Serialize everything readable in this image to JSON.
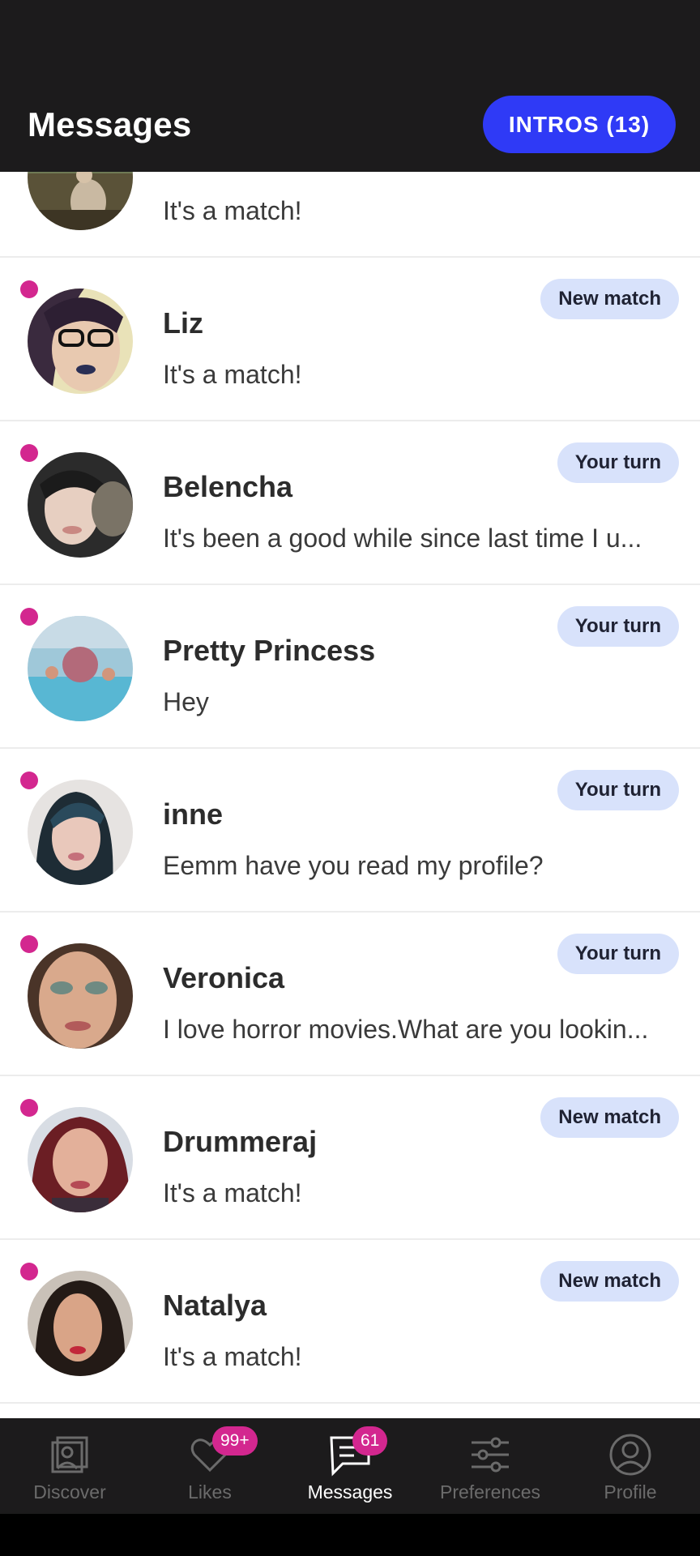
{
  "header": {
    "title": "Messages",
    "intros_label": "INTROS (13)"
  },
  "colors": {
    "header_bg": "#1c1b1c",
    "intros_button": "#2f3af6",
    "unread_dot": "#d3278f",
    "badge_bg": "#d8e2fb"
  },
  "conversations": [
    {
      "name": "",
      "preview": "It's a match!",
      "badge": "",
      "unread": false
    },
    {
      "name": "Liz",
      "preview": "It's a match!",
      "badge": "New match",
      "unread": true
    },
    {
      "name": "Belencha",
      "preview": "It's been a good while since last time I u...",
      "badge": "Your turn",
      "unread": true
    },
    {
      "name": "Pretty Princess",
      "preview": "Hey",
      "badge": "Your turn",
      "unread": true
    },
    {
      "name": "inne",
      "preview": "Eemm have you read my profile?",
      "badge": "Your turn",
      "unread": true
    },
    {
      "name": "Veronica",
      "preview": "I love horror movies.What are you lookin...",
      "badge": "Your turn",
      "unread": true
    },
    {
      "name": "Drummeraj",
      "preview": "It's a match!",
      "badge": "New match",
      "unread": true
    },
    {
      "name": "Natalya",
      "preview": "It's a match!",
      "badge": "New match",
      "unread": true
    }
  ],
  "tabs": [
    {
      "label": "Discover",
      "icon": "discover-icon",
      "badge": "",
      "active": false
    },
    {
      "label": "Likes",
      "icon": "heart-icon",
      "badge": "99+",
      "active": false
    },
    {
      "label": "Messages",
      "icon": "messages-icon",
      "badge": "61",
      "active": true
    },
    {
      "label": "Preferences",
      "icon": "sliders-icon",
      "badge": "",
      "active": false
    },
    {
      "label": "Profile",
      "icon": "profile-icon",
      "badge": "",
      "active": false
    }
  ]
}
